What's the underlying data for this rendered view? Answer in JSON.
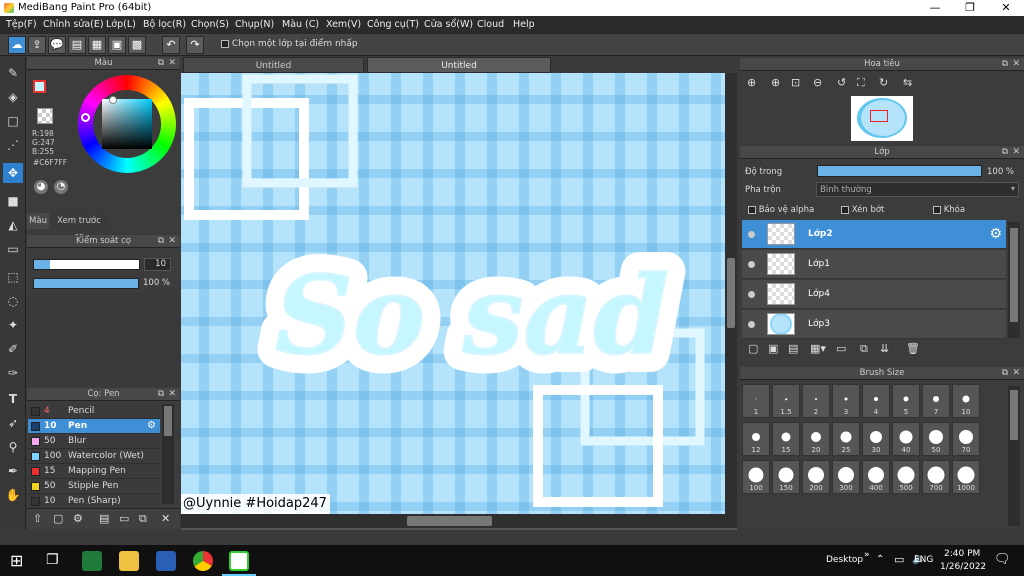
{
  "window": {
    "title": "MediBang Paint Pro (64bit)",
    "minimize": "—",
    "maximize": "❐",
    "close": "✕"
  },
  "menu": [
    "Tệp(F)",
    "Chỉnh sửa(E)",
    "Lớp(L)",
    "Bộ lọc(R)",
    "Chọn(S)",
    "Chụp(N)",
    "Màu (C)",
    "Xem(V)",
    "Công cụ(T)",
    "Cửa sổ(W)",
    "Cloud",
    "Help"
  ],
  "toolbar": {
    "checkbox_label": "Chọn một lớp tại điểm nhấp"
  },
  "color_panel": {
    "title": "Màu",
    "r": "R:198",
    "g": "G:247",
    "b": "B:255",
    "hex": "#C6F7FF",
    "tab_color": "Màu",
    "tab_preview": "Xem trước cọ",
    "current_color": "#C6F7FF"
  },
  "brush_control": {
    "title": "Kiểm soát cọ",
    "size": "10",
    "opacity": "100 %",
    "opacity_value": 100,
    "size_fill": 0.15
  },
  "brush_list": {
    "title": "Cọ: Pen",
    "items": [
      {
        "size": "4",
        "name": "Pencil",
        "color": "#333333"
      },
      {
        "size": "10",
        "name": "Pen",
        "color": "#1c3f70"
      },
      {
        "size": "50",
        "name": "Blur",
        "color": "#f8a8f0"
      },
      {
        "size": "100",
        "name": "Watercolor (Wet)",
        "color": "#7ad4ff"
      },
      {
        "size": "15",
        "name": "Mapping Pen",
        "color": "#e83030"
      },
      {
        "size": "50",
        "name": "Stipple Pen",
        "color": "#f0d020"
      },
      {
        "size": "10",
        "name": "Pen (Sharp)",
        "color": "#333333"
      }
    ]
  },
  "tabs": [
    "Untitled",
    "Untitled"
  ],
  "canvas": {
    "text": "So sad",
    "watermark": "@Uynnie #Hoidap247"
  },
  "navigator": {
    "title": "Hoa tiêu"
  },
  "layer_panel": {
    "title": "Lớp",
    "opacity_label": "Độ trong",
    "opacity": "100 %",
    "opacity_value": 100,
    "blend_label": "Pha trộn",
    "blend_value": "Bình thường",
    "protect_alpha": "Bảo vệ alpha",
    "clipping": "Xén bớt",
    "lock": "Khóa",
    "layers": [
      "Lớp2",
      "Lớp1",
      "Lớp4",
      "Lớp3"
    ]
  },
  "brush_size": {
    "title": "Brush Size",
    "sizes": [
      "1",
      "1.5",
      "2",
      "3",
      "4",
      "5",
      "7",
      "10",
      "12",
      "15",
      "20",
      "25",
      "30",
      "40",
      "50",
      "70",
      "100",
      "150",
      "200",
      "300",
      "400",
      "500",
      "700",
      "1000"
    ]
  },
  "taskbar": {
    "desktop": "Desktop",
    "lang": "ENG",
    "time": "2:40 PM",
    "date": "1/26/2022"
  }
}
